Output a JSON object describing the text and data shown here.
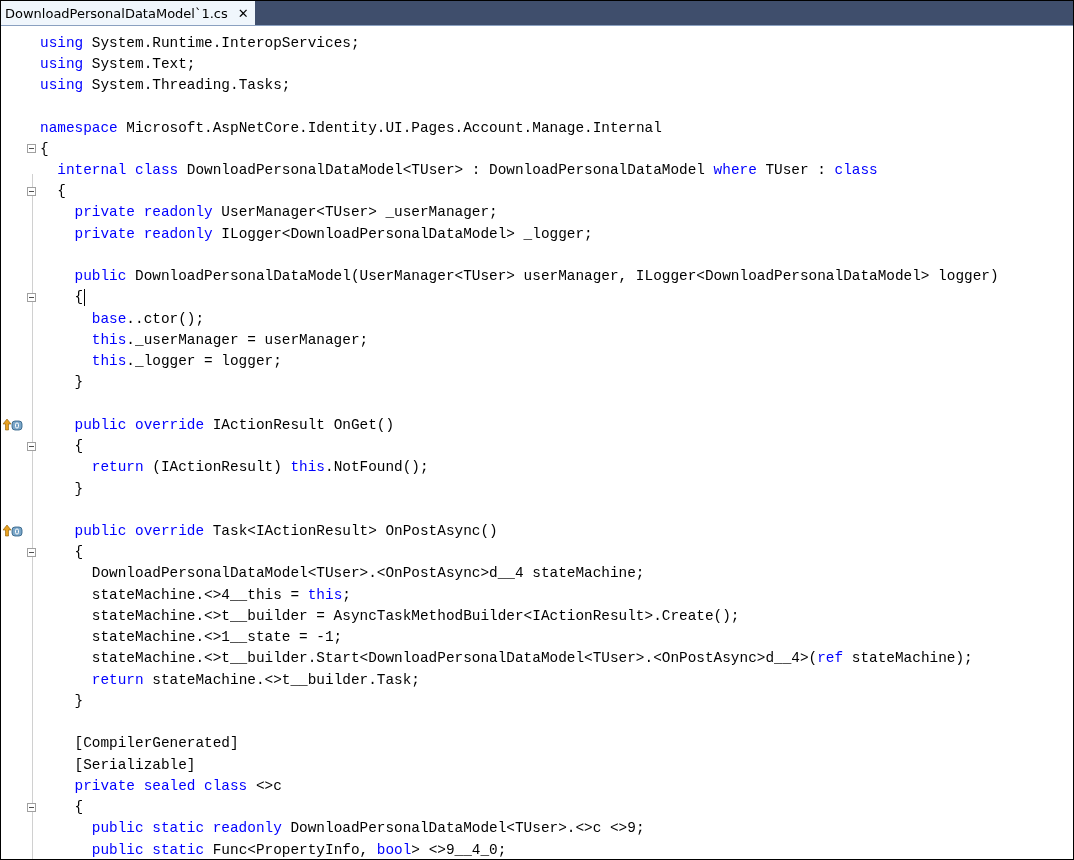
{
  "tab": {
    "title": "DownloadPersonalDataModel`1.cs",
    "close": "✕",
    "selected": true
  },
  "lines": [
    {
      "blank_before": false,
      "fold": false,
      "marker": false,
      "cursor": false,
      "tokens": [
        {
          "kind": "kw",
          "text": "using"
        },
        {
          "kind": "plain",
          "text": " System.Runtime.InteropServices;"
        }
      ]
    },
    {
      "blank_before": false,
      "fold": false,
      "marker": false,
      "cursor": false,
      "tokens": [
        {
          "kind": "kw",
          "text": "using"
        },
        {
          "kind": "plain",
          "text": " System.Text;"
        }
      ]
    },
    {
      "blank_before": false,
      "fold": false,
      "marker": false,
      "cursor": false,
      "tokens": [
        {
          "kind": "kw",
          "text": "using"
        },
        {
          "kind": "plain",
          "text": " System.Threading.Tasks;"
        }
      ]
    },
    {
      "blank_before": true,
      "fold": false,
      "marker": false,
      "cursor": false,
      "tokens": [
        {
          "kind": "kw",
          "text": "namespace"
        },
        {
          "kind": "plain",
          "text": " Microsoft.AspNetCore.Identity.UI.Pages.Account.Manage.Internal"
        }
      ]
    },
    {
      "blank_before": false,
      "fold": true,
      "marker": false,
      "cursor": false,
      "tokens": [
        {
          "kind": "plain",
          "text": "{"
        }
      ]
    },
    {
      "blank_before": false,
      "fold": false,
      "marker": false,
      "cursor": false,
      "tokens": [
        {
          "kind": "kw",
          "text": "  internal class"
        },
        {
          "kind": "plain",
          "text": " DownloadPersonalDataModel<TUser> : DownloadPersonalDataModel "
        },
        {
          "kind": "kw",
          "text": "where"
        },
        {
          "kind": "plain",
          "text": " TUser : "
        },
        {
          "kind": "kw",
          "text": "class"
        }
      ]
    },
    {
      "blank_before": false,
      "fold": true,
      "marker": false,
      "cursor": false,
      "tokens": [
        {
          "kind": "plain",
          "text": "  {"
        }
      ]
    },
    {
      "blank_before": false,
      "fold": false,
      "marker": false,
      "cursor": false,
      "tokens": [
        {
          "kind": "kw",
          "text": "    private readonly"
        },
        {
          "kind": "plain",
          "text": " UserManager<TUser> _userManager;"
        }
      ]
    },
    {
      "blank_before": false,
      "fold": false,
      "marker": false,
      "cursor": false,
      "tokens": [
        {
          "kind": "kw",
          "text": "    private readonly"
        },
        {
          "kind": "plain",
          "text": " ILogger<DownloadPersonalDataModel> _logger;"
        }
      ]
    },
    {
      "blank_before": true,
      "fold": false,
      "marker": false,
      "cursor": false,
      "tokens": [
        {
          "kind": "kw",
          "text": "    public"
        },
        {
          "kind": "plain",
          "text": " DownloadPersonalDataModel(UserManager<TUser> userManager, ILogger<DownloadPersonalDataModel> logger)"
        }
      ]
    },
    {
      "blank_before": false,
      "fold": true,
      "marker": false,
      "cursor": true,
      "tokens": [
        {
          "kind": "plain",
          "text": "    {"
        }
      ]
    },
    {
      "blank_before": false,
      "fold": false,
      "marker": false,
      "cursor": false,
      "tokens": [
        {
          "kind": "kw",
          "text": "      base"
        },
        {
          "kind": "plain",
          "text": "..ctor();"
        }
      ]
    },
    {
      "blank_before": false,
      "fold": false,
      "marker": false,
      "cursor": false,
      "tokens": [
        {
          "kind": "kw",
          "text": "      this"
        },
        {
          "kind": "plain",
          "text": "._userManager = userManager;"
        }
      ]
    },
    {
      "blank_before": false,
      "fold": false,
      "marker": false,
      "cursor": false,
      "tokens": [
        {
          "kind": "kw",
          "text": "      this"
        },
        {
          "kind": "plain",
          "text": "._logger = logger;"
        }
      ]
    },
    {
      "blank_before": false,
      "fold": false,
      "marker": false,
      "cursor": false,
      "tokens": [
        {
          "kind": "plain",
          "text": "    }"
        }
      ]
    },
    {
      "blank_before": true,
      "fold": false,
      "marker": true,
      "cursor": false,
      "tokens": [
        {
          "kind": "kw",
          "text": "    public override"
        },
        {
          "kind": "plain",
          "text": " IActionResult OnGet()"
        }
      ]
    },
    {
      "blank_before": false,
      "fold": true,
      "marker": false,
      "cursor": false,
      "tokens": [
        {
          "kind": "plain",
          "text": "    {"
        }
      ]
    },
    {
      "blank_before": false,
      "fold": false,
      "marker": false,
      "cursor": false,
      "tokens": [
        {
          "kind": "kw",
          "text": "      return"
        },
        {
          "kind": "plain",
          "text": " (IActionResult) "
        },
        {
          "kind": "kw",
          "text": "this"
        },
        {
          "kind": "plain",
          "text": ".NotFound();"
        }
      ]
    },
    {
      "blank_before": false,
      "fold": false,
      "marker": false,
      "cursor": false,
      "tokens": [
        {
          "kind": "plain",
          "text": "    }"
        }
      ]
    },
    {
      "blank_before": true,
      "fold": false,
      "marker": true,
      "cursor": false,
      "tokens": [
        {
          "kind": "kw",
          "text": "    public override"
        },
        {
          "kind": "plain",
          "text": " Task<IActionResult> OnPostAsync()"
        }
      ]
    },
    {
      "blank_before": false,
      "fold": true,
      "marker": false,
      "cursor": false,
      "tokens": [
        {
          "kind": "plain",
          "text": "    {"
        }
      ]
    },
    {
      "blank_before": false,
      "fold": false,
      "marker": false,
      "cursor": false,
      "tokens": [
        {
          "kind": "plain",
          "text": "      DownloadPersonalDataModel<TUser>.<OnPostAsync>d__4 stateMachine;"
        }
      ]
    },
    {
      "blank_before": false,
      "fold": false,
      "marker": false,
      "cursor": false,
      "tokens": [
        {
          "kind": "plain",
          "text": "      stateMachine.<>4__this = "
        },
        {
          "kind": "kw",
          "text": "this"
        },
        {
          "kind": "plain",
          "text": ";"
        }
      ]
    },
    {
      "blank_before": false,
      "fold": false,
      "marker": false,
      "cursor": false,
      "tokens": [
        {
          "kind": "plain",
          "text": "      stateMachine.<>t__builder = AsyncTaskMethodBuilder<IActionResult>.Create();"
        }
      ]
    },
    {
      "blank_before": false,
      "fold": false,
      "marker": false,
      "cursor": false,
      "tokens": [
        {
          "kind": "plain",
          "text": "      stateMachine.<>1__state = -1;"
        }
      ]
    },
    {
      "blank_before": false,
      "fold": false,
      "marker": false,
      "cursor": false,
      "tokens": [
        {
          "kind": "plain",
          "text": "      stateMachine.<>t__builder.Start<DownloadPersonalDataModel<TUser>.<OnPostAsync>d__4>("
        },
        {
          "kind": "kw",
          "text": "ref"
        },
        {
          "kind": "plain",
          "text": " stateMachine);"
        }
      ]
    },
    {
      "blank_before": false,
      "fold": false,
      "marker": false,
      "cursor": false,
      "tokens": [
        {
          "kind": "kw",
          "text": "      return"
        },
        {
          "kind": "plain",
          "text": " stateMachine.<>t__builder.Task;"
        }
      ]
    },
    {
      "blank_before": false,
      "fold": false,
      "marker": false,
      "cursor": false,
      "tokens": [
        {
          "kind": "plain",
          "text": "    }"
        }
      ]
    },
    {
      "blank_before": true,
      "fold": false,
      "marker": false,
      "cursor": false,
      "tokens": [
        {
          "kind": "plain",
          "text": "    [CompilerGenerated]"
        }
      ]
    },
    {
      "blank_before": false,
      "fold": false,
      "marker": false,
      "cursor": false,
      "tokens": [
        {
          "kind": "plain",
          "text": "    [Serializable]"
        }
      ]
    },
    {
      "blank_before": false,
      "fold": false,
      "marker": false,
      "cursor": false,
      "tokens": [
        {
          "kind": "kw",
          "text": "    private sealed class"
        },
        {
          "kind": "plain",
          "text": " <>c"
        }
      ]
    },
    {
      "blank_before": false,
      "fold": true,
      "marker": false,
      "cursor": false,
      "tokens": [
        {
          "kind": "plain",
          "text": "    {"
        }
      ]
    },
    {
      "blank_before": false,
      "fold": false,
      "marker": false,
      "cursor": false,
      "tokens": [
        {
          "kind": "kw",
          "text": "      public static readonly"
        },
        {
          "kind": "plain",
          "text": " DownloadPersonalDataModel<TUser>.<>c <>9;"
        }
      ]
    },
    {
      "blank_before": false,
      "fold": false,
      "marker": false,
      "cursor": false,
      "tokens": [
        {
          "kind": "kw",
          "text": "      public static"
        },
        {
          "kind": "plain",
          "text": " Func<PropertyInfo, "
        },
        {
          "kind": "kw",
          "text": "bool"
        },
        {
          "kind": "plain",
          "text": "> <>9__4_0;"
        }
      ]
    }
  ]
}
